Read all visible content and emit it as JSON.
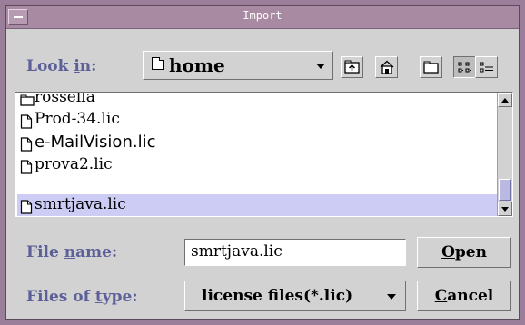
{
  "window": {
    "title": "Import"
  },
  "look_in": {
    "label_pre": "Look ",
    "label_mn": "i",
    "label_post": "n:",
    "value": "home"
  },
  "toolbar": {
    "icons": [
      "up-folder-icon",
      "home-icon",
      "new-folder-icon",
      "list-view-icon",
      "details-view-icon"
    ]
  },
  "files": [
    {
      "name": "rossella",
      "type": "folder"
    },
    {
      "name": "Prod-34.lic",
      "type": "file"
    },
    {
      "name": "e-MailVision.lic",
      "type": "file"
    },
    {
      "name": "prova2.lic",
      "type": "file"
    },
    {
      "name": "smrtjava.lic",
      "type": "file",
      "selected": true
    }
  ],
  "file_name": {
    "label_pre": "File ",
    "label_mn": "n",
    "label_post": "ame:",
    "value": "smrtjava.lic"
  },
  "file_type": {
    "label_pre": "Files of ",
    "label_mn": "t",
    "label_post": "ype:",
    "value": "license files(*.lic)"
  },
  "buttons": {
    "open_mn": "O",
    "open_rest": "pen",
    "cancel_mn": "C",
    "cancel_rest": "ancel"
  },
  "colors": {
    "titlebar": "#a98aa3",
    "label": "#5c5f98",
    "selection": "#ccccf4",
    "background": "#d2d2d2"
  }
}
